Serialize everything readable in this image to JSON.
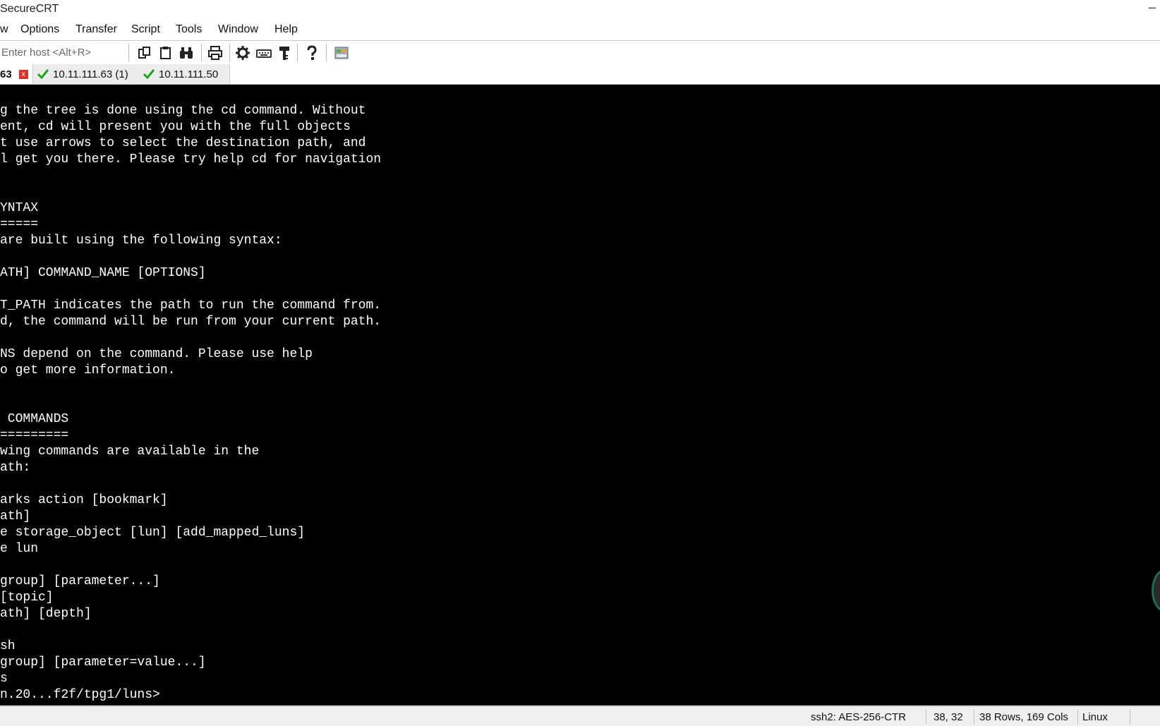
{
  "window": {
    "title": "SecureCRT",
    "minimize": "–"
  },
  "menu": [
    "w",
    "Options",
    "Transfer",
    "Script",
    "Tools",
    "Window",
    "Help"
  ],
  "toolbar": {
    "host_placeholder": "Enter host <Alt+R>",
    "buttons": [
      "copy-icon",
      "paste-icon",
      "find-icon",
      "print-icon",
      "settings-icon",
      "keymap-icon",
      "keygen-icon",
      "help-icon",
      "sftp-icon"
    ]
  },
  "tabs": [
    {
      "label": "63",
      "status": "closed"
    },
    {
      "label": "10.11.111.63 (1)",
      "status": "connected"
    },
    {
      "label": "10.11.111.50",
      "status": "connected"
    }
  ],
  "terminal": {
    "lines": [
      "g the tree is done using the cd command. Without",
      "ent, cd will present you with the full objects",
      "t use arrows to select the destination path, and",
      "l get you there. Please try help cd for navigation",
      "",
      "",
      "YNTAX",
      "=====",
      "are built using the following syntax:",
      "",
      "ATH] COMMAND_NAME [OPTIONS]",
      "",
      "T_PATH indicates the path to run the command from.",
      "d, the command will be run from your current path.",
      "",
      "NS depend on the command. Please use help",
      "o get more information.",
      "",
      "",
      " COMMANDS",
      "=========",
      "wing commands are available in the",
      "ath:",
      "",
      "arks action [bookmark]",
      "ath]",
      "e storage_object [lun] [add_mapped_luns]",
      "e lun",
      "",
      "group] [parameter...]",
      "[topic]",
      "ath] [depth]",
      "",
      "sh",
      "group] [parameter=value...]",
      "s",
      "n.20...f2f/tpg1/luns>"
    ]
  },
  "status": {
    "cipher": "ssh2: AES-256-CTR",
    "cursor": "38,  32",
    "size": "38 Rows, 169 Cols",
    "os": "Linux"
  },
  "colors": {
    "terminal_bg": "#000000",
    "terminal_fg": "#ffffff",
    "check_green": "#1fa31f",
    "close_red": "#d9342b"
  }
}
